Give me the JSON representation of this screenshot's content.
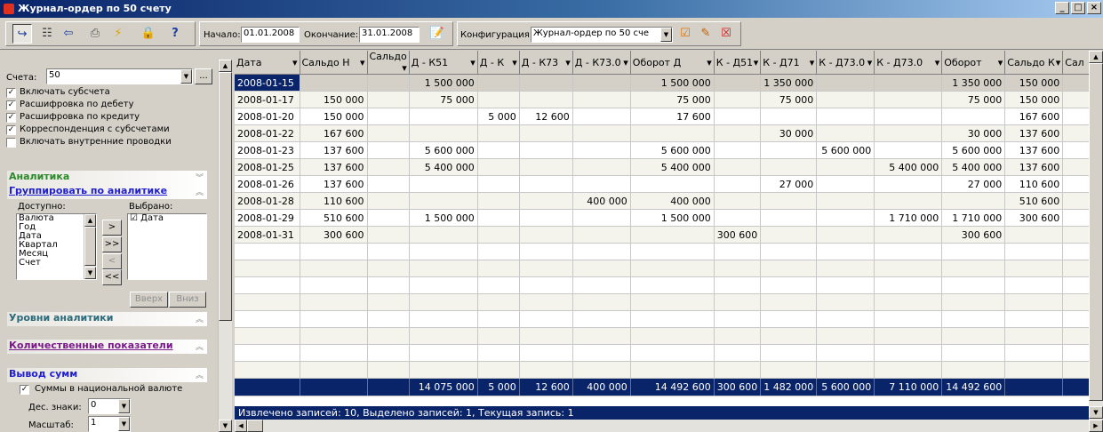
{
  "window": {
    "title": "Журнал-ордер по 50 счету",
    "buttons": [
      "_",
      "□",
      "×"
    ]
  },
  "toolbar": {
    "start_label": "Начало:",
    "start_value": "01.01.2008",
    "end_label": "Окончание:",
    "end_value": "31.01.2008",
    "config_label": "Конфигурация:",
    "config_value": "Журнал-ордер по 50 сче"
  },
  "left": {
    "account_label": "Счета:",
    "account_value": "50",
    "checks": [
      {
        "label": "Включать субсчета",
        "checked": true
      },
      {
        "label": "Расшифровка по дебету",
        "checked": true
      },
      {
        "label": "Расшифровка по кредиту",
        "checked": true
      },
      {
        "label": "Корреспонденция с субсчетами",
        "checked": true
      },
      {
        "label": "Включать внутренние проводки",
        "checked": false
      }
    ],
    "sec_analytics": "Аналитика",
    "sec_group": "Группировать по аналитике",
    "available_label": "Доступно:",
    "selected_label": "Выбрано:",
    "available_items": [
      "Валюта",
      "Год",
      "Дата",
      "Квартал",
      "Месяц",
      "Счет"
    ],
    "selected_items": [
      "Дата"
    ],
    "btn_up": "Вверх",
    "btn_down": "Вниз",
    "sec_levels": "Уровни аналитики",
    "sec_quantity": "Количественные показатели",
    "sec_output": "Вывод сумм",
    "national_currency_label": "Суммы в национальной валюте",
    "decimals_label": "Дес. знаки:",
    "decimals_value": "0",
    "scale_label": "Масштаб:",
    "scale_value": "1",
    "colors": {
      "analytics": "#2a8a2a",
      "group": "#1f1fd0",
      "levels": "#2a6a7a",
      "quantity": "#7a1a8a",
      "output": "#1f1fd0"
    }
  },
  "grid": {
    "headers": [
      "Дата",
      "Сальдо Н",
      "Сальдо",
      "Д - К51",
      "Д - К",
      "Д - К73",
      "Д - К73.0",
      "Оборот Д",
      "К - Д51",
      "К - Д71",
      "К - Д73.0",
      "К - Д73.0",
      "Оборот",
      "Сальдо К",
      "Сал"
    ],
    "rows": [
      [
        "2008-01-15",
        "",
        "",
        "1 500 000",
        "",
        "",
        "",
        "1 500 000",
        "",
        "1 350 000",
        "",
        "",
        "1 350 000",
        "150 000",
        ""
      ],
      [
        "2008-01-17",
        "150 000",
        "",
        "75 000",
        "",
        "",
        "",
        "75 000",
        "",
        "75 000",
        "",
        "",
        "75 000",
        "150 000",
        ""
      ],
      [
        "2008-01-20",
        "150 000",
        "",
        "",
        "5 000",
        "12 600",
        "",
        "17 600",
        "",
        "",
        "",
        "",
        "",
        "167 600",
        ""
      ],
      [
        "2008-01-22",
        "167 600",
        "",
        "",
        "",
        "",
        "",
        "",
        "",
        "30 000",
        "",
        "",
        "30 000",
        "137 600",
        ""
      ],
      [
        "2008-01-23",
        "137 600",
        "",
        "5 600 000",
        "",
        "",
        "",
        "5 600 000",
        "",
        "",
        "5 600 000",
        "",
        "5 600 000",
        "137 600",
        ""
      ],
      [
        "2008-01-25",
        "137 600",
        "",
        "5 400 000",
        "",
        "",
        "",
        "5 400 000",
        "",
        "",
        "",
        "5 400 000",
        "5 400 000",
        "137 600",
        ""
      ],
      [
        "2008-01-26",
        "137 600",
        "",
        "",
        "",
        "",
        "",
        "",
        "",
        "27 000",
        "",
        "",
        "27 000",
        "110 600",
        ""
      ],
      [
        "2008-01-28",
        "110 600",
        "",
        "",
        "",
        "",
        "400 000",
        "400 000",
        "",
        "",
        "",
        "",
        "",
        "510 600",
        ""
      ],
      [
        "2008-01-29",
        "510 600",
        "",
        "1 500 000",
        "",
        "",
        "",
        "1 500 000",
        "",
        "",
        "",
        "1 710 000",
        "1 710 000",
        "300 600",
        ""
      ],
      [
        "2008-01-31",
        "300 600",
        "",
        "",
        "",
        "",
        "",
        "",
        "300 600",
        "",
        "",
        "",
        "300 600",
        "",
        ""
      ]
    ],
    "totals": [
      "",
      "",
      "",
      "14 075 000",
      "5 000",
      "12 600",
      "400 000",
      "14 492 600",
      "300 600",
      "1 482 000",
      "5 600 000",
      "7 110 000",
      "14 492 600",
      "",
      ""
    ],
    "status": "Извлечено записей: 10, Выделено записей: 1, Текущая запись: 1"
  }
}
